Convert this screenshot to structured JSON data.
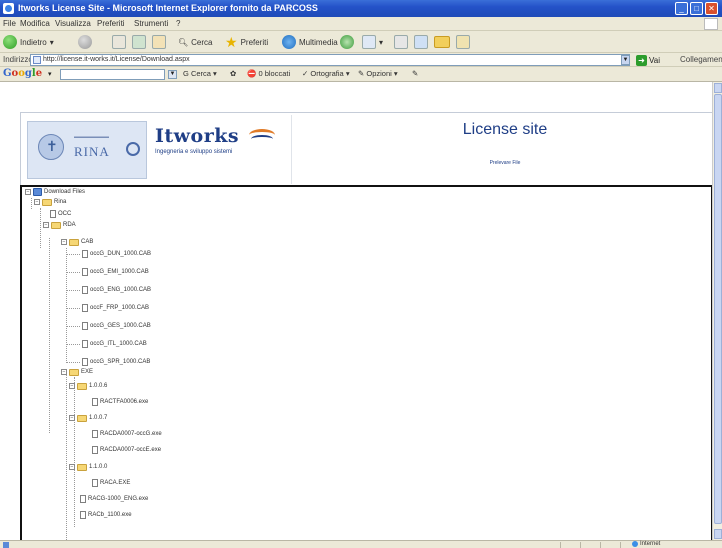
{
  "window": {
    "title": "Itworks License Site - Microsoft Internet Explorer fornito da PARCOSS"
  },
  "menu": {
    "items": [
      "File",
      "Modifica",
      "Visualizza",
      "Preferiti",
      "Strumenti",
      "?"
    ]
  },
  "toolbar": {
    "back_label": "Indietro",
    "search_label": "Cerca",
    "favorites_label": "Preferiti",
    "multimedia_label": "Multimedia"
  },
  "address": {
    "label": "Indirizzo",
    "url": "http://license.it-works.it/License/Download.aspx",
    "go_label": "Vai",
    "links_label": "Collegamenti"
  },
  "google": {
    "logo": [
      "G",
      "o",
      "o",
      "g",
      "l",
      "e"
    ],
    "search_web": "Cerca",
    "blocked": "0 bloccati",
    "spell": "Ortografia",
    "options": "Opzioni"
  },
  "header": {
    "rina_text": "RINA",
    "itworks_title": "Itworks",
    "itworks_sub": "Ingegneria e sviluppo sistemi",
    "site_title": "License site",
    "site_sub": "Prelevare File"
  },
  "tree": {
    "root": "Download Files",
    "nodes": [
      {
        "label": "Rina",
        "type": "folder",
        "expander": "-"
      },
      {
        "label": "OCC",
        "type": "file",
        "expander": ""
      },
      {
        "label": "RDA",
        "type": "folder",
        "expander": "-"
      },
      {
        "label": "CAB",
        "type": "folder",
        "expander": "-"
      },
      {
        "label": "occG_DUN_1000.CAB",
        "type": "file",
        "expander": ""
      },
      {
        "label": "occG_EMI_1000.CAB",
        "type": "file",
        "expander": ""
      },
      {
        "label": "occG_ENG_1000.CAB",
        "type": "file",
        "expander": ""
      },
      {
        "label": "occF_FRP_1000.CAB",
        "type": "file",
        "expander": ""
      },
      {
        "label": "occG_GES_1000.CAB",
        "type": "file",
        "expander": ""
      },
      {
        "label": "occG_ITL_1000.CAB",
        "type": "file",
        "expander": ""
      },
      {
        "label": "occG_SPR_1000.CAB",
        "type": "file",
        "expander": ""
      },
      {
        "label": "EXE",
        "type": "folder",
        "expander": "-"
      },
      {
        "label": "1.0.0.6",
        "type": "folder",
        "expander": "-"
      },
      {
        "label": "RACTFA0006.exe",
        "type": "file",
        "expander": ""
      },
      {
        "label": "1.0.0.7",
        "type": "folder",
        "expander": "-"
      },
      {
        "label": "RACDA0007-occG.exe",
        "type": "file",
        "expander": ""
      },
      {
        "label": "RACDA0007-occE.exe",
        "type": "file",
        "expander": ""
      },
      {
        "label": "1.1.0.0",
        "type": "folder",
        "expander": "-"
      },
      {
        "label": "RACA.EXE",
        "type": "file",
        "expander": ""
      },
      {
        "label": "RACG-1000_ENG.exe",
        "type": "file",
        "expander": ""
      },
      {
        "label": "RACb_1100.exe",
        "type": "file",
        "expander": ""
      }
    ]
  },
  "status": {
    "zone": "Internet"
  }
}
